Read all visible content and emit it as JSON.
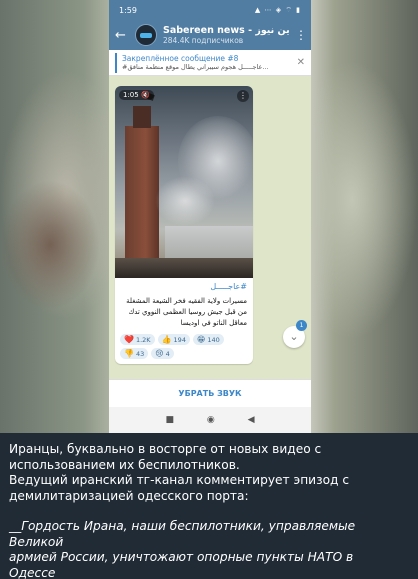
{
  "status_bar": {
    "time": "1:59",
    "icons": "▲ ⋯ ◈ ⌔ ▮"
  },
  "header": {
    "back_icon": "back-arrow-icon",
    "channel_name": "Sabereen news - ين نيوز",
    "subscribers": "284.4K подписчиков",
    "menu_icon": "kebab-menu-icon"
  },
  "pinned": {
    "title": "Закреплённое сообщение #8",
    "message": "#عاجـــــل  هجوم سيبراني يطال موقع منظمة منافق...",
    "icon": "unpin-icon"
  },
  "message": {
    "video_time": "1:05",
    "tag": "#عاجـــــل",
    "body": "مسيرات ولاية الفقيه فخر الشيعة المشغلة من قبل جيش روسيا العظمى النووي تدك معاقل الناتو في اوديسا",
    "reactions": [
      {
        "emoji": "❤️",
        "count": "1.2K"
      },
      {
        "emoji": "👍",
        "count": "194"
      },
      {
        "emoji": "😁",
        "count": "140"
      },
      {
        "emoji": "👎",
        "count": "43"
      },
      {
        "emoji": "😢",
        "count": "4"
      }
    ]
  },
  "scroll_badge": "1",
  "mute_button": "УБРАТЬ ЗВУК",
  "nav": {
    "stop": "■",
    "home": "◉",
    "back": "◀"
  },
  "caption": {
    "line1": "Иранцы, буквально в восторге от новых видео с",
    "line2": "использованием их беспилотников.",
    "line3": "Ведущий иранский тг-канал комментирует эпизод с",
    "line4": "демилитаризацией одесского порта:",
    "quote1": "__Гордость Ирана, наши беспилотники, управляемые Великой",
    "quote2": "армией России, уничтожают опорные пункты НАТО в Одессе__"
  }
}
